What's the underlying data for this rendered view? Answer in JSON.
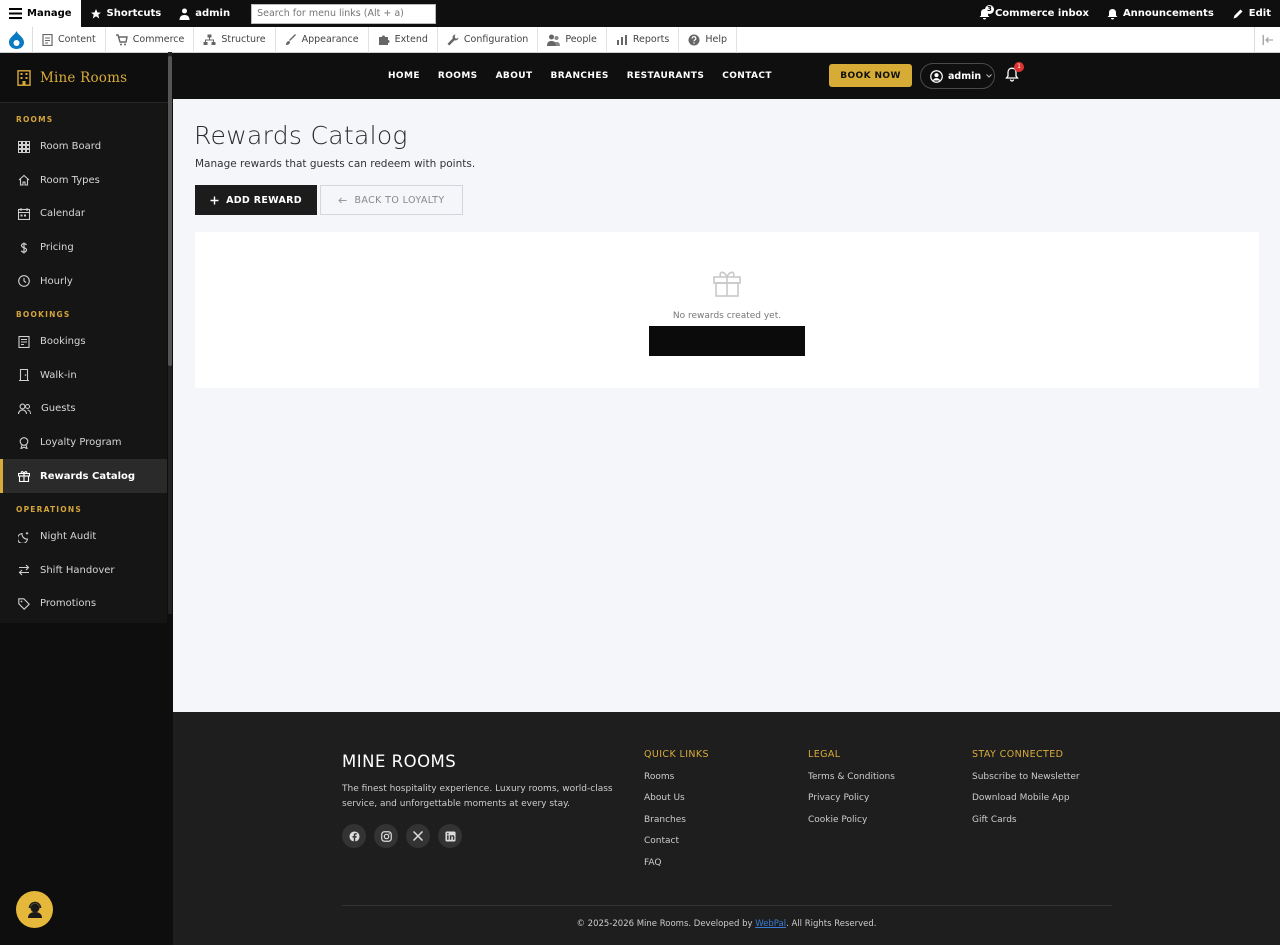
{
  "toolbar": {
    "manage": "Manage",
    "shortcuts": "Shortcuts",
    "user": "admin",
    "search_placeholder": "Search for menu links (Alt + a)",
    "commerce_inbox": "Commerce inbox",
    "commerce_inbox_count": "3",
    "announcements": "Announcements",
    "edit": "Edit"
  },
  "tray": {
    "items": [
      "Content",
      "Commerce",
      "Structure",
      "Appearance",
      "Extend",
      "Configuration",
      "People",
      "Reports",
      "Help"
    ]
  },
  "brand": {
    "name": "Mine Rooms"
  },
  "sidebar": {
    "sections": [
      {
        "title": "ROOMS",
        "items": [
          "Room Board",
          "Room Types",
          "Calendar",
          "Pricing",
          "Hourly"
        ]
      },
      {
        "title": "BOOKINGS",
        "items": [
          "Bookings",
          "Walk-in",
          "Guests",
          "Loyalty Program",
          "Rewards Catalog"
        ]
      },
      {
        "title": "OPERATIONS",
        "items": [
          "Night Audit",
          "Shift Handover",
          "Promotions"
        ]
      }
    ],
    "active_item": "Rewards Catalog"
  },
  "nav": {
    "links": [
      "HOME",
      "ROOMS",
      "ABOUT",
      "BRANCHES",
      "RESTAURANTS",
      "CONTACT"
    ],
    "book_now": "BOOK NOW",
    "user": "admin",
    "notification_count": "1"
  },
  "page": {
    "title": "Rewards Catalog",
    "subtitle": "Manage rewards that guests can redeem with points.",
    "add_button": "ADD REWARD",
    "back_button": "BACK TO LOYALTY",
    "empty_text": "No rewards created yet."
  },
  "footer": {
    "brand": "MINE ROOMS",
    "description": "The finest hospitality experience. Luxury rooms, world-class service, and unforgettable moments at every stay.",
    "columns": [
      {
        "title": "QUICK LINKS",
        "links": [
          "Rooms",
          "About Us",
          "Branches",
          "Contact",
          "FAQ"
        ]
      },
      {
        "title": "LEGAL",
        "links": [
          "Terms & Conditions",
          "Privacy Policy",
          "Cookie Policy"
        ]
      },
      {
        "title": "STAY CONNECTED",
        "links": [
          "Subscribe to Newsletter",
          "Download Mobile App",
          "Gift Cards"
        ]
      }
    ],
    "copyright_prefix": "© 2025-2026 Mine Rooms. Developed by ",
    "developer": "WebPal",
    "copyright_suffix": ". All Rights Reserved."
  },
  "colors": {
    "accent": "#d9ab3a",
    "dark": "#0e0e0e",
    "background": "#f4f6f9"
  }
}
